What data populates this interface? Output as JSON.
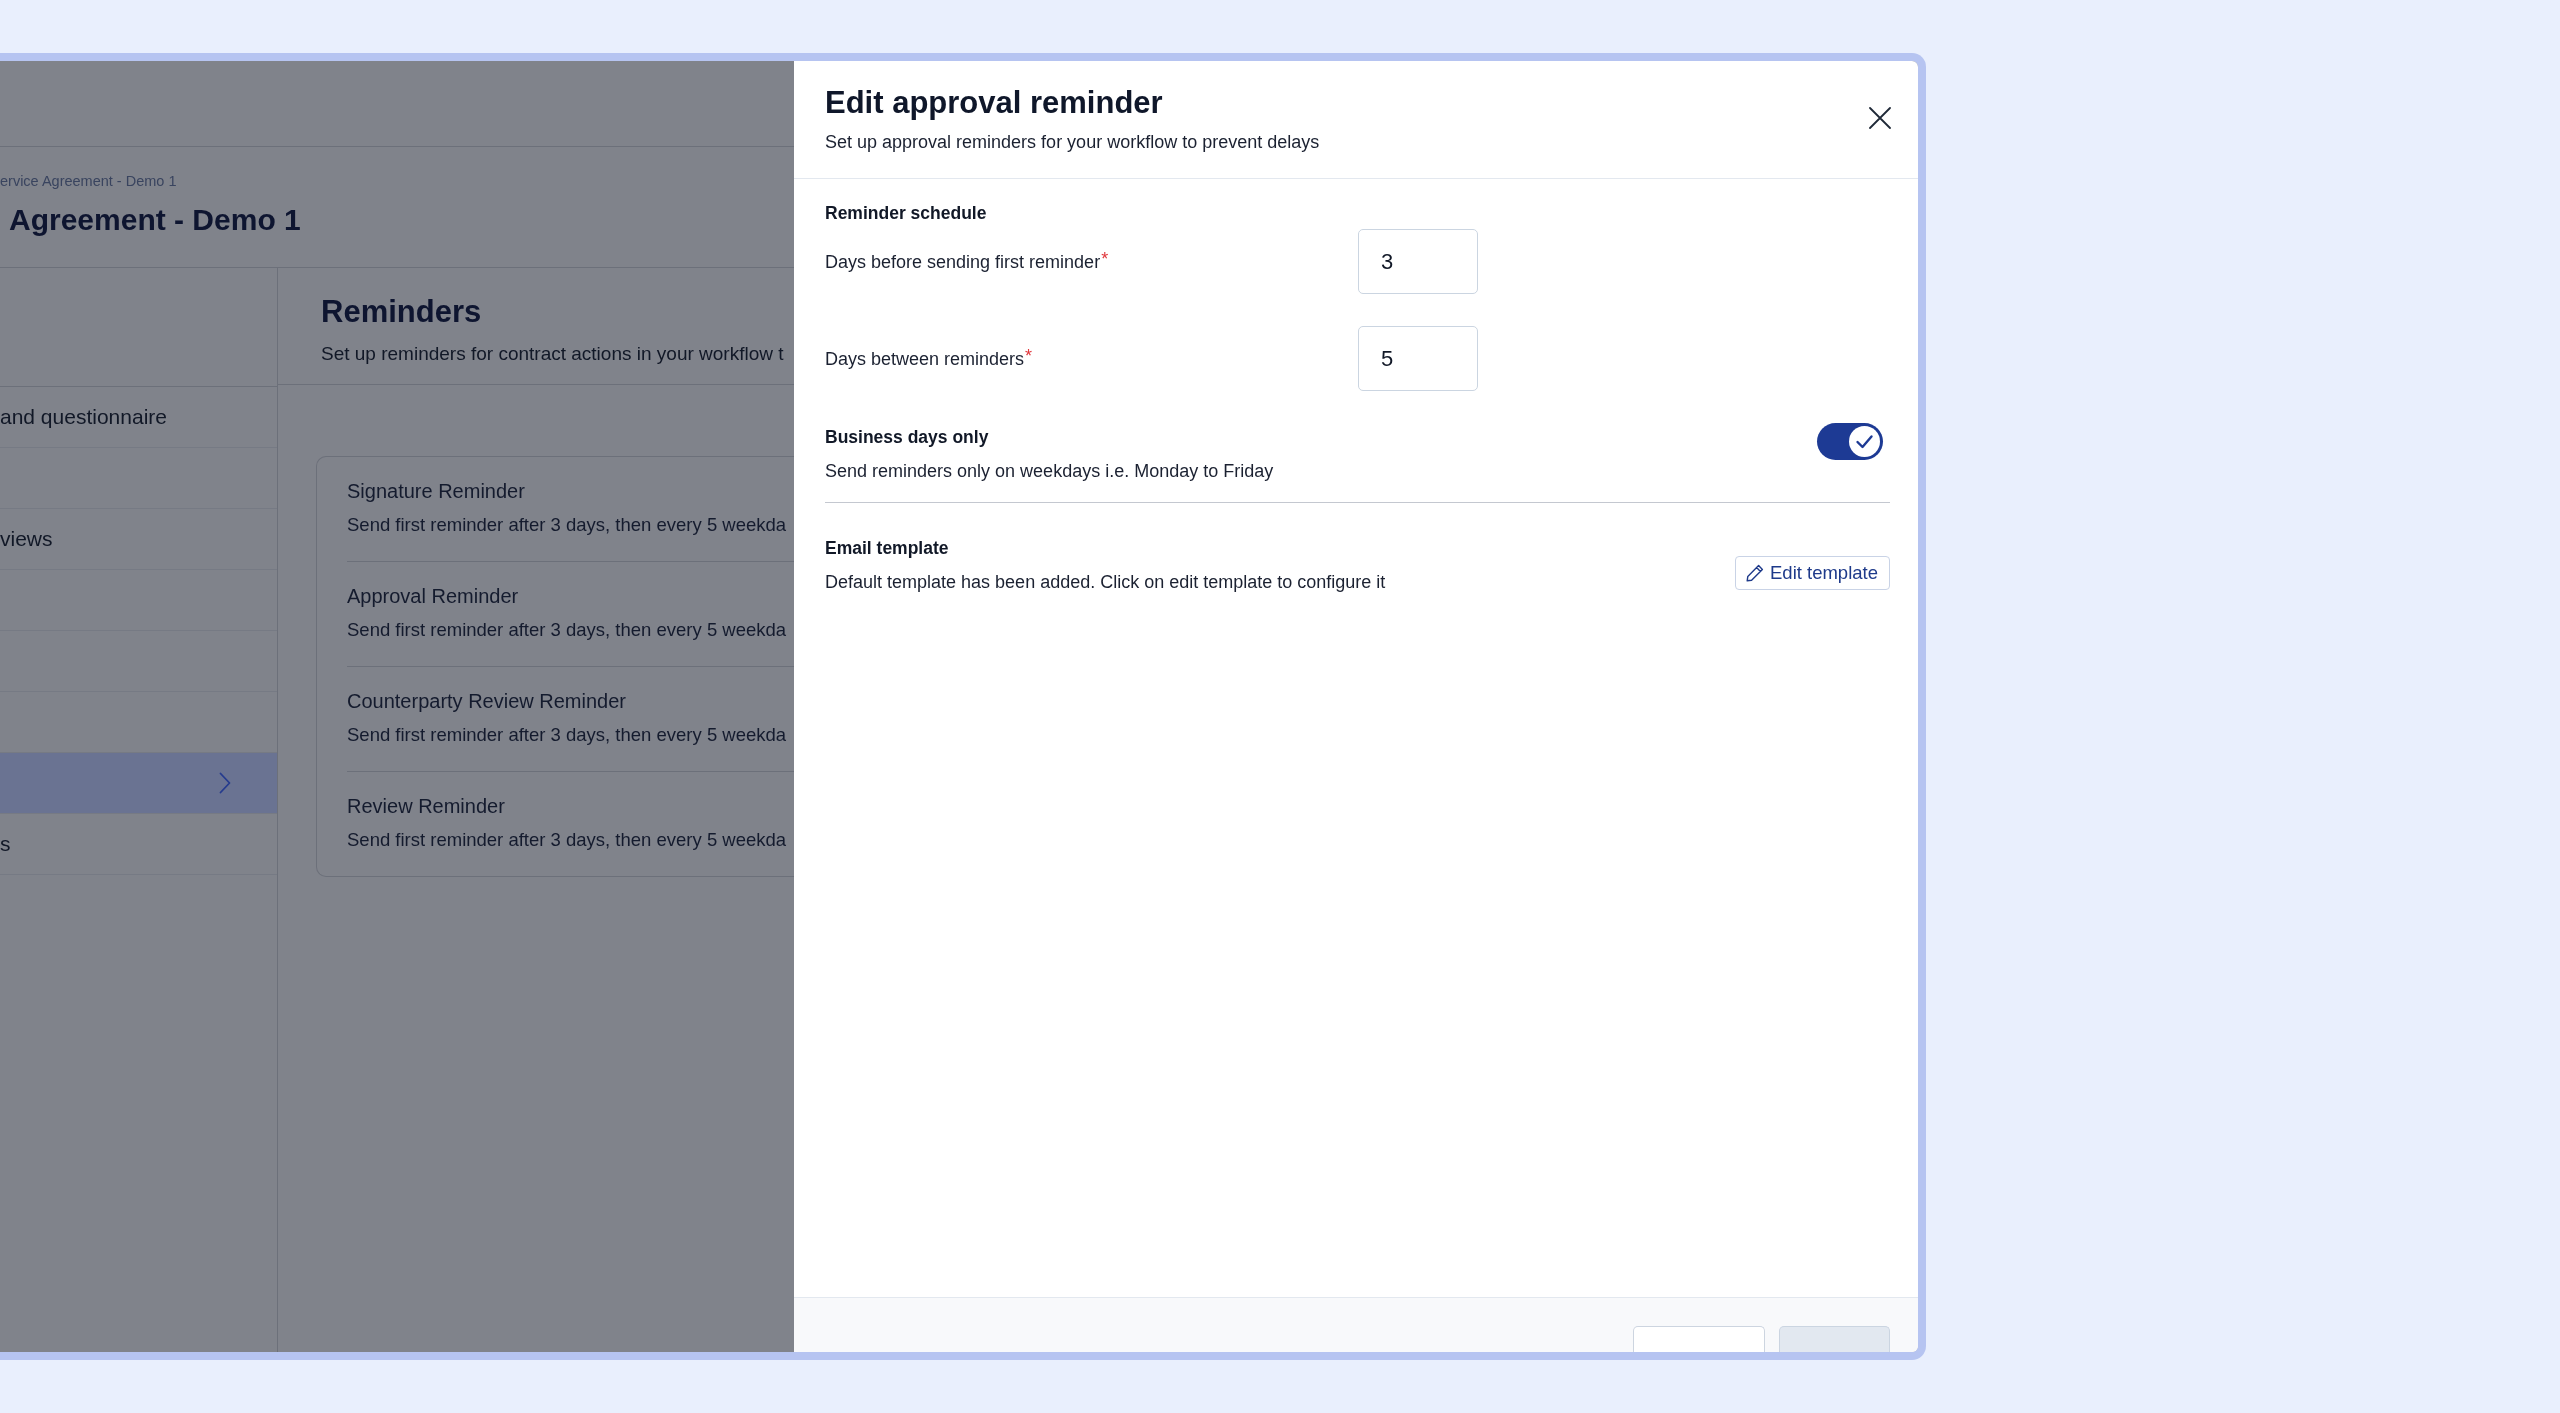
{
  "app": {
    "breadcrumb": "ervice Agreement - Demo 1",
    "title": "Agreement - Demo 1",
    "sidebar": {
      "items": [
        {
          "label": "and questionnaire",
          "selected": false
        },
        {
          "selected": false
        },
        {
          "label": "views",
          "selected": false
        },
        {
          "selected": false
        },
        {
          "selected": false
        },
        {
          "selected": false
        },
        {
          "selected": true
        },
        {
          "label": "s",
          "selected": false
        }
      ]
    },
    "page": {
      "title": "Reminders",
      "subtitle": "Set up reminders for contract actions in your workflow t"
    },
    "reminders": [
      {
        "title": "Signature Reminder",
        "description": "Send first reminder after 3 days, then every 5 weekda"
      },
      {
        "title": "Approval Reminder",
        "description": "Send first reminder after 3 days, then every 5 weekda"
      },
      {
        "title": "Counterparty Review Reminder",
        "description": "Send first reminder after 3 days, then every 5 weekda"
      },
      {
        "title": "Review Reminder",
        "description": "Send first reminder after 3 days, then every 5 weekda"
      }
    ]
  },
  "dialog": {
    "title": "Edit approval reminder",
    "subtitle": "Set up approval reminders for your workflow to prevent delays",
    "section_title": "Reminder schedule",
    "fields": [
      {
        "label": "Days before sending first reminder",
        "required_mark": "*",
        "value": "3"
      },
      {
        "label": "Days between reminders",
        "required_mark": "*",
        "value": "5"
      }
    ],
    "business_days": {
      "title": "Business days only",
      "description": "Send reminders only on weekdays i.e. Monday to Friday",
      "on": true
    },
    "email_template": {
      "title": "Email template",
      "description": "Default template has been added. Click on edit template to configure it",
      "button": "Edit template"
    },
    "footer_buttons": [
      {
        "kind": "outline",
        "disabled": false
      },
      {
        "kind": "primary",
        "disabled": true
      }
    ]
  }
}
